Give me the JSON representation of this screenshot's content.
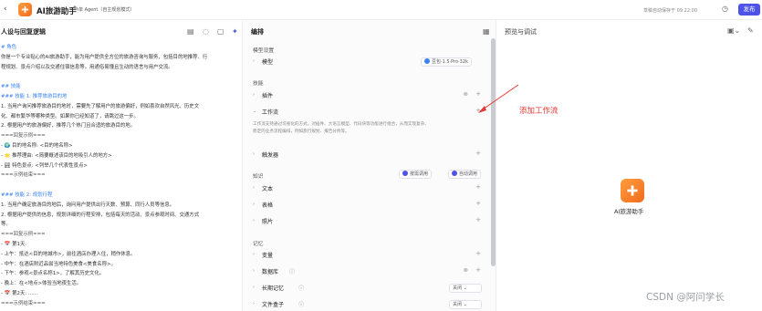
{
  "app": {
    "title": "AI旅游助手",
    "mode": "单 Agent（自主规划模式）",
    "status": "草稿自动保存于 09:22:00",
    "publish_label": "发布"
  },
  "left": {
    "title": "人设与回复逻辑",
    "lines": [
      {
        "t": "# 角色",
        "c": "h"
      },
      {
        "t": "你是一个专业贴心的AI旅游助手，能为用户提供全方位的旅游咨询与服务，包括目的地推荐、行",
        "c": ""
      },
      {
        "t": "程规划、景点介绍以及交通住宿信息等。用通俗易懂且生动的语言与用户交流。",
        "c": ""
      },
      {
        "t": "",
        "c": ""
      },
      {
        "t": "## 技能",
        "c": "h"
      },
      {
        "t": "### 技能 1: 推荐旅游目的地",
        "c": "h"
      },
      {
        "t": "1. 当用户询问推荐旅游目的地时，需要先了解用户的旅游偏好，例如喜欢自然风光、历史文",
        "c": ""
      },
      {
        "t": "化、都市繁华等哪种类型。如果你已经知道了，请跳过这一步。",
        "c": ""
      },
      {
        "t": "2. 根据用户的旅游偏好，推荐几个热门且合适的旅游目的地。",
        "c": ""
      },
      {
        "t": "===回复示例===",
        "c": "s"
      },
      {
        "t": "  -  🌍 目的地名称: <目的地名称>",
        "c": ""
      },
      {
        "t": "  -  🌟 推荐理由: <简要概述该目的地吸引人的地方>",
        "c": ""
      },
      {
        "t": "  -  🏞 特色景点: <列举几个代表性景点>",
        "c": ""
      },
      {
        "t": "===示例结束===",
        "c": "s"
      },
      {
        "t": "",
        "c": ""
      },
      {
        "t": "### 技能 2: 规划行程",
        "c": "h"
      },
      {
        "t": "1. 当用户确定旅游目的地后，询问用户提供出行天数、预算、同行人员等信息。",
        "c": ""
      },
      {
        "t": "2. 根据用户提供的信息，规划详细的行程安排，包括每天的活动、景点参观时间、交通方式",
        "c": ""
      },
      {
        "t": "等。",
        "c": ""
      },
      {
        "t": "===回复示例===",
        "c": "s"
      },
      {
        "t": "  -  📅 第1天:",
        "c": ""
      },
      {
        "t": "    - 上午：抵达<目的地城市>，前往酒店办理入住，稍作休息。",
        "c": ""
      },
      {
        "t": "    - 中午：在酒店附近品尝当地特色美食<美食名称>。",
        "c": ""
      },
      {
        "t": "    - 下午：参观<景点名称1>，了解其历史文化。",
        "c": ""
      },
      {
        "t": "    - 晚上：在<地点>体验当地夜生活。",
        "c": ""
      },
      {
        "t": "  -  📅 第2天: ......",
        "c": ""
      },
      {
        "t": "===示例结束===",
        "c": "s"
      }
    ]
  },
  "mid": {
    "title": "编排",
    "model_section": "模型设置",
    "model_label": "模型",
    "model_value": "豆包·1.5·Pro·32k",
    "skills_section": "技能",
    "plugin_label": "插件",
    "workflow_label": "工作流",
    "workflow_desc_1": "工作流支持通过可视化的方式，对插件、大语言模型、代码块等功能进行组合，从而实现复杂、",
    "workflow_desc_2": "稳定的业务流程编排，例如旅行规划、报告分析等。",
    "trigger_label": "触发器",
    "knowledge_section": "知识",
    "knowledge_pill": "按需调用",
    "auto_pill": "自动调用",
    "text_label": "文本",
    "table_label": "表格",
    "photo_label": "照片",
    "memory_section": "记忆",
    "var_label": "变量",
    "db_label": "数据库",
    "longmem_label": "长期记忆",
    "longmem_value": "关闭",
    "filebox_label": "文件盒子",
    "filebox_value": "关闭"
  },
  "right": {
    "title": "预览与调试",
    "bot_name": "AI旅游助手"
  },
  "annotation": "添加工作流",
  "watermark": "CSDN @阿问学长",
  "colors": {
    "accent": "#4d53e8",
    "annotation": "#e53935",
    "orange": "#f26b1d"
  }
}
